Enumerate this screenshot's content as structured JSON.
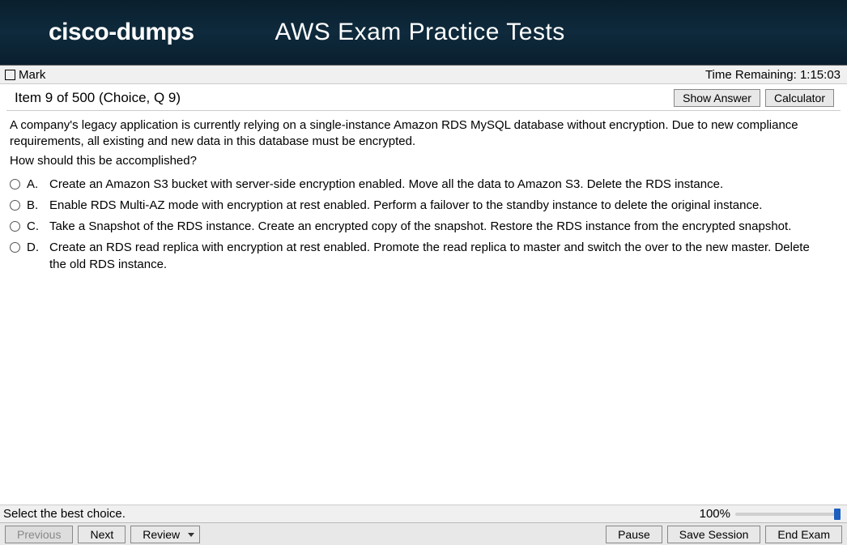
{
  "header": {
    "logo": "cisco-dumps",
    "title": "AWS Exam Practice Tests"
  },
  "topbar": {
    "mark_label": "Mark",
    "timer_label": "Time Remaining:",
    "timer_value": "1:15:03"
  },
  "item": {
    "label": "Item 9 of 500 (Choice, Q 9)",
    "show_answer": "Show Answer",
    "calculator": "Calculator"
  },
  "question": {
    "stem": "A company's legacy application is currently relying on a single-instance Amazon RDS MySQL database without encryption. Due to new compliance requirements, all existing and new data in this database must be encrypted.",
    "prompt": "How should this be accomplished?",
    "options": [
      {
        "letter": "A.",
        "text": "Create an Amazon S3 bucket with server-side encryption enabled. Move all the data to Amazon S3. Delete the RDS instance."
      },
      {
        "letter": "B.",
        "text": "Enable RDS Multi-AZ mode with encryption at rest enabled. Perform a failover to the standby instance to delete the original instance."
      },
      {
        "letter": "C.",
        "text": "Take a Snapshot of the RDS instance. Create an encrypted copy of the snapshot. Restore the RDS instance from the encrypted snapshot."
      },
      {
        "letter": "D.",
        "text": "Create an RDS read replica with encryption at rest enabled. Promote the read replica to master and switch the over to the new master. Delete the old RDS instance."
      }
    ]
  },
  "instruction": {
    "text": "Select the best choice.",
    "progress_pct": "100%"
  },
  "footer": {
    "previous": "Previous",
    "next": "Next",
    "review": "Review",
    "pause": "Pause",
    "save_session": "Save Session",
    "end_exam": "End Exam"
  }
}
